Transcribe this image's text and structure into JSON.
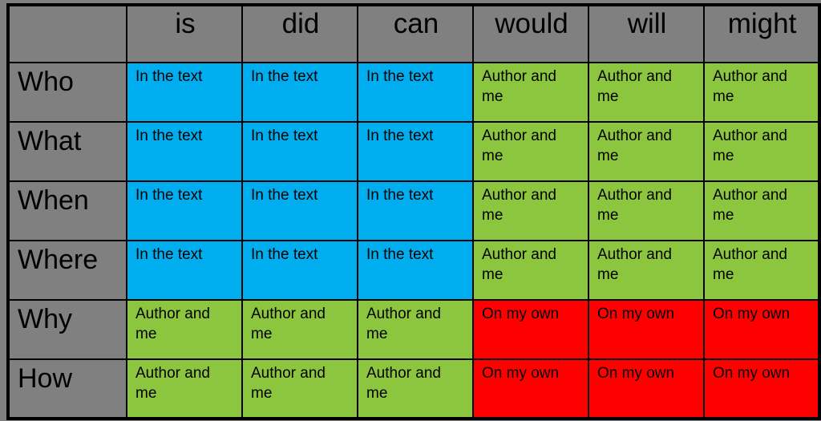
{
  "colors": {
    "page_background": "#808080",
    "header_background": "#808080",
    "border": "#000000",
    "in_the_text": "#00adef",
    "author_and_me": "#8cc63f",
    "on_my_own": "#ff0000",
    "text": "#000000"
  },
  "table": {
    "corner_label": "",
    "column_headers": [
      "is",
      "did",
      "can",
      "would",
      "will",
      "might"
    ],
    "row_headers": [
      "Who",
      "What",
      "When",
      "Where",
      "Why",
      "How"
    ],
    "answer_labels": {
      "in_the_text": "In the text",
      "author_and_me": "Author and me",
      "on_my_own": "On my own"
    },
    "rows": [
      {
        "header": "Who",
        "cells": [
          {
            "text": "In the text",
            "category": "in-the-text"
          },
          {
            "text": "In the text",
            "category": "in-the-text"
          },
          {
            "text": "In the text",
            "category": "in-the-text"
          },
          {
            "text": "Author and me",
            "category": "author-and-me"
          },
          {
            "text": "Author and me",
            "category": "author-and-me"
          },
          {
            "text": "Author and me",
            "category": "author-and-me"
          }
        ]
      },
      {
        "header": "What",
        "cells": [
          {
            "text": "In the text",
            "category": "in-the-text"
          },
          {
            "text": "In the text",
            "category": "in-the-text"
          },
          {
            "text": "In the text",
            "category": "in-the-text"
          },
          {
            "text": "Author and me",
            "category": "author-and-me"
          },
          {
            "text": "Author and me",
            "category": "author-and-me"
          },
          {
            "text": "Author and me",
            "category": "author-and-me"
          }
        ]
      },
      {
        "header": "When",
        "cells": [
          {
            "text": "In the text",
            "category": "in-the-text"
          },
          {
            "text": "In the text",
            "category": "in-the-text"
          },
          {
            "text": "In the text",
            "category": "in-the-text"
          },
          {
            "text": "Author and me",
            "category": "author-and-me"
          },
          {
            "text": "Author and me",
            "category": "author-and-me"
          },
          {
            "text": "Author and me",
            "category": "author-and-me"
          }
        ]
      },
      {
        "header": "Where",
        "cells": [
          {
            "text": "In the text",
            "category": "in-the-text"
          },
          {
            "text": "In the text",
            "category": "in-the-text"
          },
          {
            "text": "In the text",
            "category": "in-the-text"
          },
          {
            "text": "Author and me",
            "category": "author-and-me"
          },
          {
            "text": "Author and me",
            "category": "author-and-me"
          },
          {
            "text": "Author and me",
            "category": "author-and-me"
          }
        ]
      },
      {
        "header": "Why",
        "cells": [
          {
            "text": "Author and me",
            "category": "author-and-me"
          },
          {
            "text": "Author and me",
            "category": "author-and-me"
          },
          {
            "text": "Author and me",
            "category": "author-and-me"
          },
          {
            "text": "On my own",
            "category": "on-my-own"
          },
          {
            "text": "On my own",
            "category": "on-my-own"
          },
          {
            "text": "On my own",
            "category": "on-my-own"
          }
        ]
      },
      {
        "header": "How",
        "cells": [
          {
            "text": "Author and me",
            "category": "author-and-me"
          },
          {
            "text": "Author and me",
            "category": "author-and-me"
          },
          {
            "text": "Author and me",
            "category": "author-and-me"
          },
          {
            "text": "On my own",
            "category": "on-my-own"
          },
          {
            "text": "On my own",
            "category": "on-my-own"
          },
          {
            "text": "On my own",
            "category": "on-my-own"
          }
        ]
      }
    ]
  }
}
